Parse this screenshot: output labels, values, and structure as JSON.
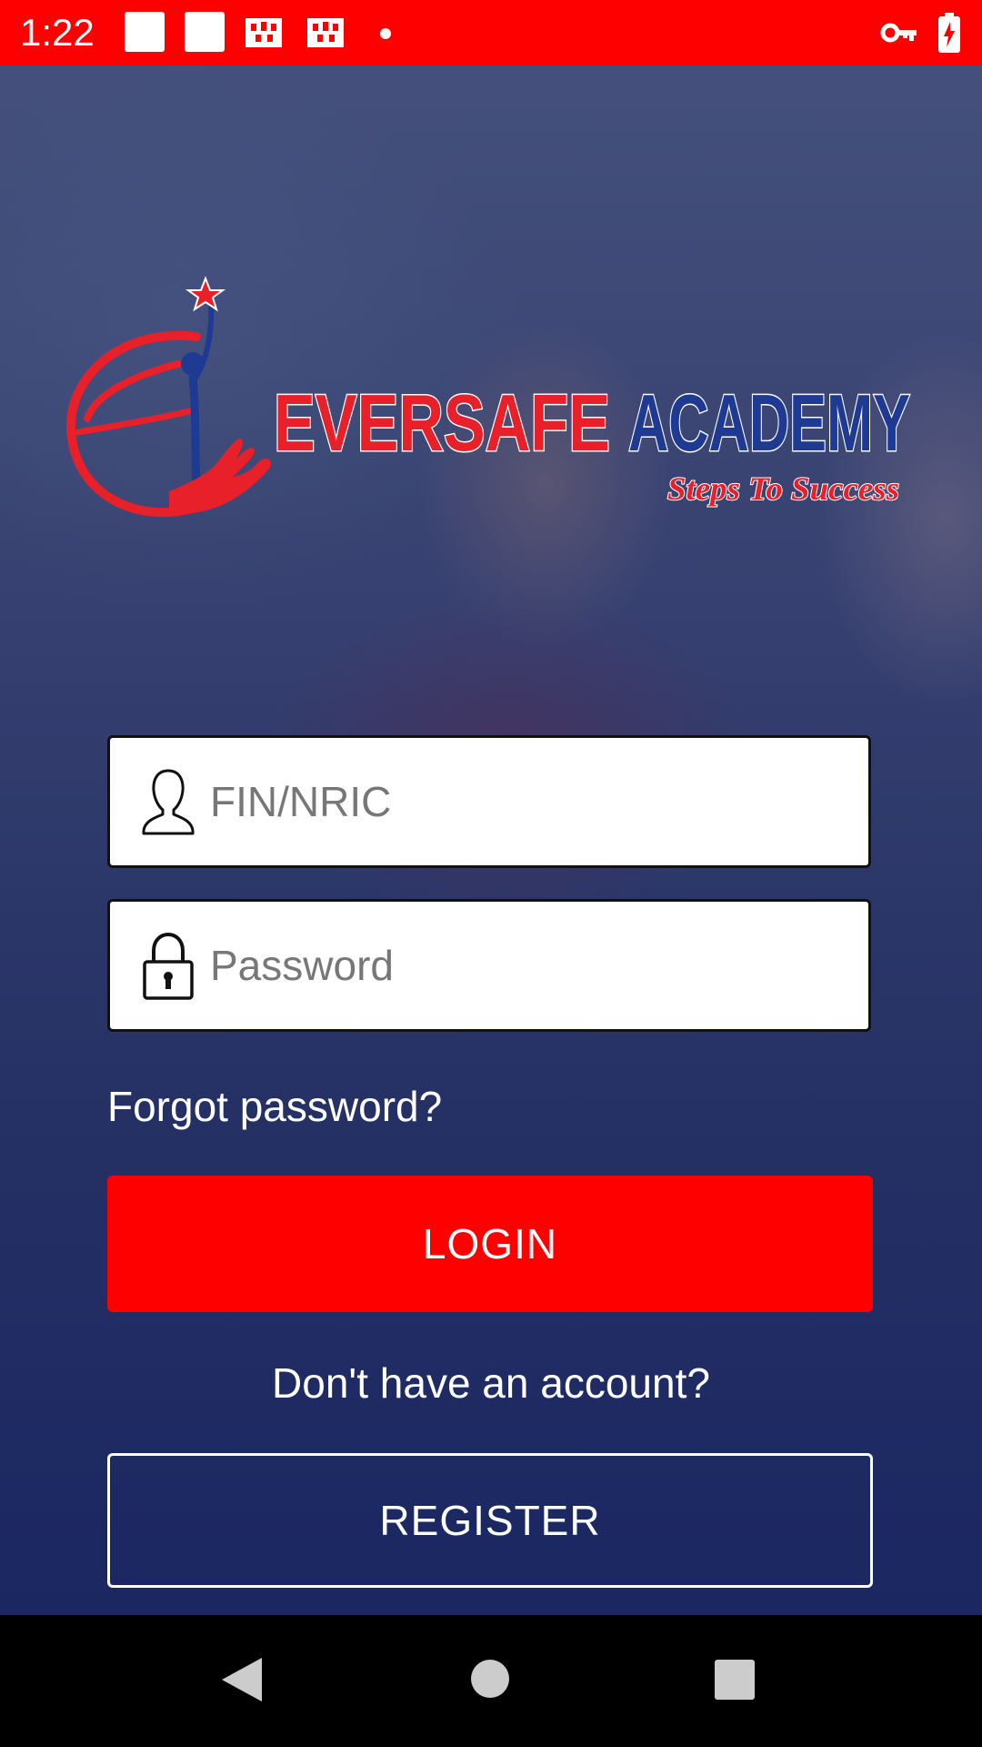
{
  "status_bar": {
    "time": "1:22",
    "background_color": "#ff0000",
    "icons": [
      "square-icon",
      "square-icon",
      "notification-icon",
      "notification-icon",
      "dot-icon",
      "vpn-key-icon",
      "battery-charging-icon"
    ]
  },
  "logo": {
    "brand_left": "EVERSAFE",
    "brand_right": "ACADEMY",
    "tagline": "Steps To Success"
  },
  "login_form": {
    "username": {
      "placeholder": "FIN/NRIC",
      "value": "",
      "icon": "user-icon"
    },
    "password": {
      "placeholder": "Password",
      "value": "",
      "icon": "lock-icon"
    },
    "forgot_label": "Forgot password?",
    "login_label": "LOGIN",
    "no_account_label": "Don't have an account?",
    "register_label": "REGISTER"
  },
  "nav_bar": {
    "icons": [
      "back-icon",
      "home-icon",
      "recents-icon"
    ]
  },
  "colors": {
    "accent": "#ff0000",
    "brand_blue": "#1f3a93"
  }
}
